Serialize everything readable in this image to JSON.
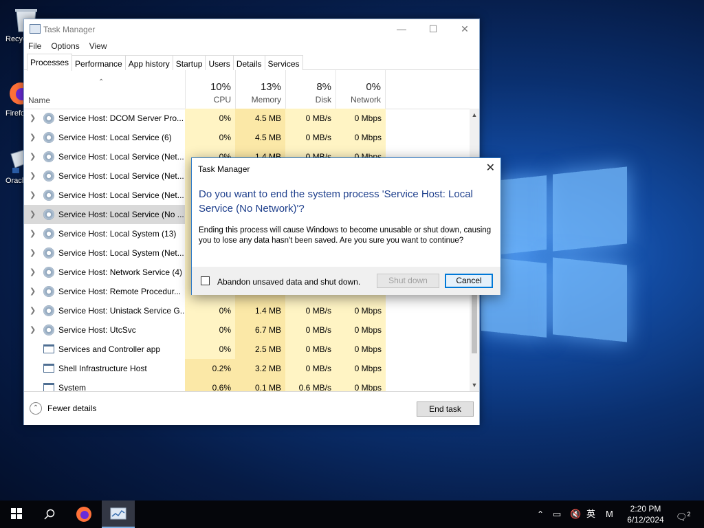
{
  "desktop": {
    "icons": [
      {
        "label": "Recycle Bin"
      },
      {
        "label": "Firefox"
      },
      {
        "label": "Oracle VirtualBox"
      }
    ]
  },
  "task_manager": {
    "title": "Task Manager",
    "menu": [
      "File",
      "Options",
      "View"
    ],
    "tabs": [
      "Processes",
      "Performance",
      "App history",
      "Startup",
      "Users",
      "Details",
      "Services"
    ],
    "active_tab": "Processes",
    "columns": {
      "name": "Name",
      "cpu": {
        "pct": "10%",
        "label": "CPU"
      },
      "memory": {
        "pct": "13%",
        "label": "Memory"
      },
      "disk": {
        "pct": "8%",
        "label": "Disk"
      },
      "network": {
        "pct": "0%",
        "label": "Network"
      }
    },
    "processes": [
      {
        "name": "Service Host: DCOM Server Pro...",
        "cpu": "0%",
        "memory": "4.5 MB",
        "disk": "0 MB/s",
        "network": "0 Mbps",
        "expandable": true,
        "icon": "gear-icon"
      },
      {
        "name": "Service Host: Local Service (6)",
        "cpu": "0%",
        "memory": "4.5 MB",
        "disk": "0 MB/s",
        "network": "0 Mbps",
        "expandable": true,
        "icon": "gear-icon"
      },
      {
        "name": "Service Host: Local Service (Net...",
        "cpu": "0%",
        "memory": "1.4 MB",
        "disk": "0 MB/s",
        "network": "0 Mbps",
        "expandable": true,
        "icon": "gear-icon"
      },
      {
        "name": "Service Host: Local Service (Net...",
        "cpu": "",
        "memory": "",
        "disk": "",
        "network": "",
        "expandable": true,
        "icon": "gear-icon"
      },
      {
        "name": "Service Host: Local Service (Net...",
        "cpu": "",
        "memory": "",
        "disk": "",
        "network": "",
        "expandable": true,
        "icon": "gear-icon"
      },
      {
        "name": "Service Host: Local Service (No ...",
        "cpu": "",
        "memory": "",
        "disk": "",
        "network": "",
        "expandable": true,
        "icon": "gear-icon",
        "selected": true
      },
      {
        "name": "Service Host: Local System (13)",
        "cpu": "",
        "memory": "",
        "disk": "",
        "network": "",
        "expandable": true,
        "icon": "gear-icon"
      },
      {
        "name": "Service Host: Local System (Net...",
        "cpu": "",
        "memory": "",
        "disk": "",
        "network": "",
        "expandable": true,
        "icon": "gear-icon"
      },
      {
        "name": "Service Host: Network Service (4)",
        "cpu": "",
        "memory": "",
        "disk": "",
        "network": "",
        "expandable": true,
        "icon": "gear-icon"
      },
      {
        "name": "Service Host: Remote Procedur...",
        "cpu": "",
        "memory": "",
        "disk": "",
        "network": "",
        "expandable": true,
        "icon": "gear-icon"
      },
      {
        "name": "Service Host: Unistack Service G...",
        "cpu": "0%",
        "memory": "1.4 MB",
        "disk": "0 MB/s",
        "network": "0 Mbps",
        "expandable": true,
        "icon": "gear-icon"
      },
      {
        "name": "Service Host: UtcSvc",
        "cpu": "0%",
        "memory": "6.7 MB",
        "disk": "0 MB/s",
        "network": "0 Mbps",
        "expandable": true,
        "icon": "gear-icon"
      },
      {
        "name": "Services and Controller app",
        "cpu": "0%",
        "memory": "2.5 MB",
        "disk": "0 MB/s",
        "network": "0 Mbps",
        "expandable": false,
        "icon": "app-window-icon"
      },
      {
        "name": "Shell Infrastructure Host",
        "cpu": "0.2%",
        "memory": "3.2 MB",
        "disk": "0 MB/s",
        "network": "0 Mbps",
        "expandable": false,
        "icon": "app-window-icon"
      },
      {
        "name": "System",
        "cpu": "0.6%",
        "memory": "0.1 MB",
        "disk": "0.6 MB/s",
        "network": "0 Mbps",
        "expandable": false,
        "icon": "app-window-icon"
      }
    ],
    "fewer_details": "Fewer details",
    "end_task": "End task"
  },
  "dialog": {
    "title": "Task Manager",
    "heading": "Do you want to end the system process 'Service Host: Local Service (No Network)'?",
    "body": "Ending this process will cause Windows to become unusable or shut down, causing you to lose any data hasn't been saved. Are you sure you want to continue?",
    "checkbox_label": "Abandon unsaved data and shut down.",
    "checkbox_checked": false,
    "shutdown_button": "Shut down",
    "shutdown_enabled": false,
    "cancel_button": "Cancel"
  },
  "taskbar": {
    "ime": "英",
    "ime_mode": "M",
    "time": "2:20 PM",
    "date": "6/12/2024",
    "notifications": "2"
  }
}
